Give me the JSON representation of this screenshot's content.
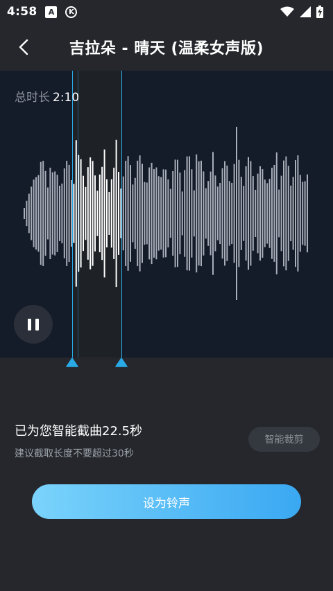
{
  "status_bar": {
    "time": "4:58",
    "app_icon_a": "A",
    "app_icon_k": "K"
  },
  "header": {
    "title": "吉拉朵 - 晴天 (温柔女声版)"
  },
  "waveform": {
    "duration_label": "总时长",
    "duration_value": "2:10"
  },
  "clip": {
    "title": "已为您智能截曲22.5秒",
    "hint": "建议截取长度不要超过30秒",
    "smart_cut_label": "智能裁剪"
  },
  "actions": {
    "set_ringtone_label": "设为铃声"
  },
  "colors": {
    "background": "#25272c",
    "wave_panel": "#141b29",
    "handle": "#29a9e6",
    "button_gradient_start": "#7ad3fb",
    "button_gradient_end": "#3aa8f2"
  }
}
